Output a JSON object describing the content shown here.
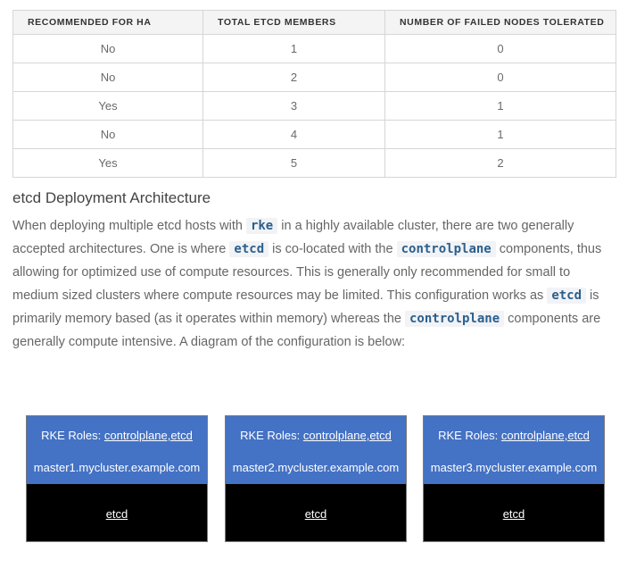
{
  "table": {
    "headers": [
      "RECOMMENDED FOR HA",
      "TOTAL ETCD MEMBERS",
      "NUMBER OF FAILED NODES TOLERATED"
    ],
    "rows": [
      [
        "No",
        "1",
        "0"
      ],
      [
        "No",
        "2",
        "0"
      ],
      [
        "Yes",
        "3",
        "1"
      ],
      [
        "No",
        "4",
        "1"
      ],
      [
        "Yes",
        "5",
        "2"
      ]
    ]
  },
  "section": {
    "title": "etcd Deployment Architecture",
    "paragraph": {
      "t1": "When deploying multiple etcd hosts with ",
      "c1": "rke",
      "t2": " in a highly available cluster, there are two generally accepted architectures. One is where ",
      "c2": "etcd",
      "t3": " is co-located with the ",
      "c3": "controlplane",
      "t4": " components, thus allowing for optimized use of compute resources. This is generally only recommended for small to medium sized clusters where compute resources may be limited. This configuration works as ",
      "c4": "etcd",
      "t5": " is primarily memory based (as it operates within memory) whereas the ",
      "c5": "controlplane",
      "t6": " components are generally compute intensive. A diagram of the configuration is below:"
    }
  },
  "diagram": {
    "nodes": [
      {
        "roles_prefix": "RKE Roles: ",
        "roles": "controlplane,etcd",
        "host": "master1.mycluster.example.com",
        "service": "etcd"
      },
      {
        "roles_prefix": "RKE Roles: ",
        "roles": "controlplane,etcd",
        "host": "master2.mycluster.example.com",
        "service": "etcd"
      },
      {
        "roles_prefix": "RKE Roles: ",
        "roles": "controlplane,etcd",
        "host": "master3.mycluster.example.com",
        "service": "etcd"
      }
    ],
    "colors": {
      "node_top": "#4472c4",
      "node_bottom": "#000000",
      "code_text": "#2b5f8c"
    }
  }
}
